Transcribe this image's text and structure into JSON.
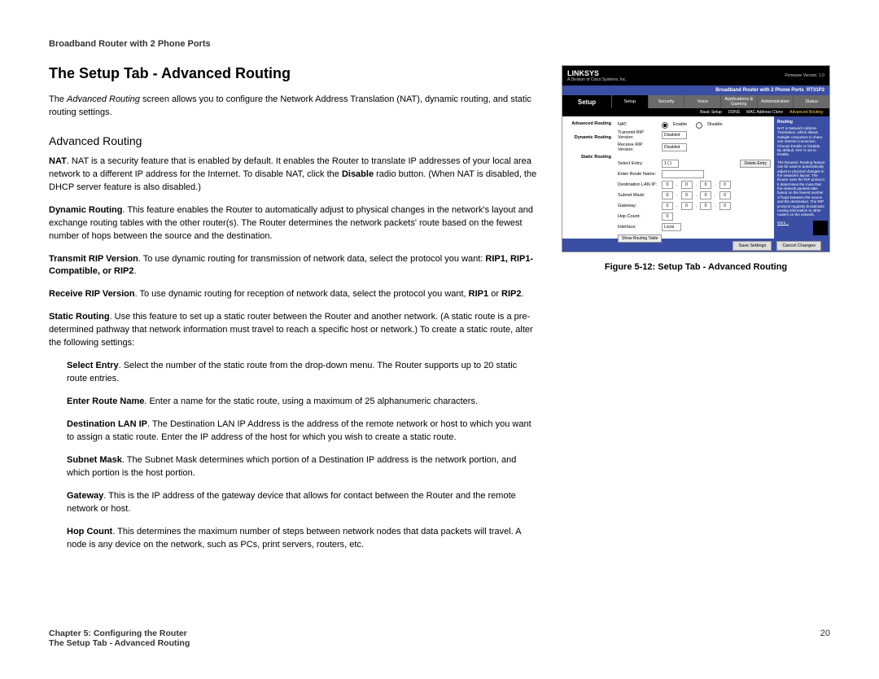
{
  "header": "Broadband Router with 2 Phone Ports",
  "title": "The Setup Tab - Advanced Routing",
  "intro": "The Advanced Routing screen allows you to configure the Network Address Translation (NAT), dynamic routing, and static routing settings.",
  "subheading": "Advanced Routing",
  "nat_label": "NAT",
  "nat_text": ". NAT is a security feature that is enabled by default. It enables the Router to translate IP addresses of your local area network to a different IP address for the Internet. To disable NAT, click the ",
  "nat_bold": "Disable",
  "nat_text2": " radio button. (When NAT is disabled, the DHCP server feature is also disabled.)",
  "dyn_label": "Dynamic Routing",
  "dyn_text": ". This feature enables the Router to automatically adjust to physical changes in the network's layout and exchange routing tables with the other router(s). The Router determines the network packets' route based on the fewest number of hops between the source and the destination.",
  "trip_label": "Transmit RIP Version",
  "trip_text": ". To use dynamic routing for transmission of network data, select the protocol you want: ",
  "trip_opts": "RIP1, RIP1-Compatible, or RIP2",
  "rrip_label": "Receive RIP Version",
  "rrip_text": ". To use dynamic routing for reception of network data, select the protocol you want, ",
  "rrip_opts1": "RIP1",
  "rrip_or": " or ",
  "rrip_opts2": "RIP2",
  "static_label": "Static Routing",
  "static_text": ". Use this feature to set up a static router between the Router and another network. (A static route is a pre-determined pathway that network information must travel to reach a specific host or network.) To create a static route, alter the following settings:",
  "se_label": "Select Entry",
  "se_text": ". Select the number of the static route from the drop-down menu. The Router supports up to 20 static route entries.",
  "ern_label": "Enter Route Name",
  "ern_text": ". Enter a name for the static route, using a maximum of 25 alphanumeric characters.",
  "dip_label": "Destination LAN IP",
  "dip_text": ". The Destination LAN IP Address is the address of the remote network or host to which you want to assign a static route. Enter the IP address of the host for which you wish to create a static route.",
  "sm_label": "Subnet Mask",
  "sm_text": ". The Subnet Mask determines which portion of a Destination IP address is the network portion, and which portion is the host portion.",
  "gw_label": "Gateway",
  "gw_text": ". This is the IP address of the gateway device that allows for contact between the Router and the remote network or host.",
  "hc_label": "Hop Count",
  "hc_text": ". This determines the maximum number of steps between network nodes that data packets will travel. A node is any device on the network, such as PCs, print servers, routers, etc.",
  "footer_chapter": "Chapter 5: Configuring the Router",
  "footer_section": "The Setup Tab - Advanced Routing",
  "page_number": "20",
  "caption": "Figure 5-12: Setup Tab - Advanced Routing",
  "shot": {
    "logo": "LINKSYS",
    "logo_sub": "A Division of Cisco Systems, Inc.",
    "model_bar": "Broadband Router with 2 Phone Ports",
    "model": "RT31P2",
    "setup_label": "Setup",
    "tabs": [
      "Setup",
      "Security",
      "Voice",
      "Applications & Gaming",
      "Administration",
      "Status"
    ],
    "subtabs": [
      "Basic Setup",
      "DDNS",
      "MAC Address Clone",
      "Advanced Routing"
    ],
    "side_adv": "Advanced Routing",
    "side_dyn": "Dynamic Routing",
    "side_static": "Static Routing",
    "nat": "NAT:",
    "enable": "Enable",
    "disable": "Disable",
    "transmit": "Transmit RIP Version:",
    "receive": "Receive RIP Version:",
    "disabled_opt": "Disabled",
    "select_entry": "Select Entry:",
    "entry_val": "1 ( )",
    "delete_entry": "Delete Entry",
    "route_name": "Enter Route Name:",
    "dest_ip": "Destination LAN IP:",
    "subnet": "Subnet Mask:",
    "gateway": "Gateway:",
    "hop": "Hop Count:",
    "interface": "Interface:",
    "interface_val": "Local",
    "show_table": "Show Routing Table",
    "save": "Save Settings",
    "cancel": "Cancel Changes",
    "help_title": "Routing",
    "help_nat": "NAT is Network Address Translation, which allows multiple computers to share one internet connection. Choose Enable or Disable. By default, NAT is set to Enable.",
    "help_dyn": "The Dynamic Routing feature can be used to automatically adjust to physical changes in the network's layout. The Router uses the RIP protocol. It determines the route that the network packets take based on the fewest number of hops between the source and the destination. The RIP protocol regularly broadcasts routing information to other routers on the network.",
    "help_more": "More..."
  }
}
